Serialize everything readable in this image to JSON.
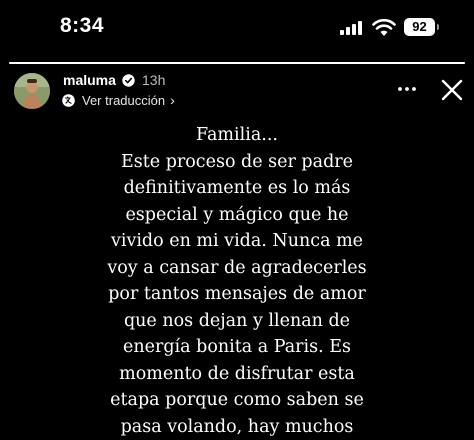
{
  "status_bar": {
    "time": "8:34",
    "battery_level": "92",
    "icons": [
      "cellular-signal-icon",
      "wifi-icon",
      "battery-icon"
    ]
  },
  "story": {
    "progress_fraction": 1.0,
    "author": {
      "username": "maluma",
      "verified": true,
      "time_ago": "13h"
    },
    "translate_label": "Ver traducción",
    "icons": [
      "globe-translate-icon",
      "chevron-right-icon",
      "more-options-icon",
      "close-icon"
    ],
    "text_lines": [
      "Familia...",
      "Este proceso de ser padre",
      "definitivamente es lo más",
      "especial y mágico que he",
      "vivido en mi vida. Nunca me",
      "voy a cansar de agradecerles",
      "por tantos mensajes de amor",
      "que nos dejan y llenan de",
      "energía bonita a Paris. Es",
      "momento de disfrutar esta",
      "etapa porque como saben se",
      "pasa volando, hay muchos"
    ]
  },
  "colors": {
    "background": "#000000",
    "text": "#ffffff",
    "secondary_text": "#bdbdbd",
    "verified_badge": "#3897f0",
    "progress_track": "#5b5b5b"
  }
}
